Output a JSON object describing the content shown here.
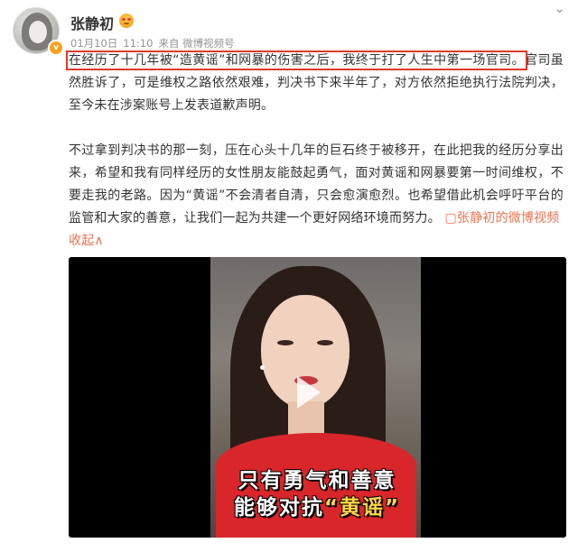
{
  "user": {
    "name": "张静初",
    "verified_badge": "v",
    "name_emoji_icon": "emoji-face-icon"
  },
  "meta": {
    "date": "01月10日",
    "time": "11:10",
    "source": "来自 微博视频号"
  },
  "post": {
    "highlighted": "在经历了十几年被“造黄谣”和网暴的伤害之后，我终于打了人生中第一场官司。",
    "p1_rest": "官司虽然胜诉了，可是维权之路依然艰难，判决书下来半年了，对方依然拒绝执行法院判决，至今未在涉案账号上发表道歉声明。",
    "p2": "不过拿到判决书的那一刻，压在心头十几年的巨石终于被移开，在此把我的经历分享出来，希望和我有同样经历的女性朋友能鼓起勇气，面对黄谣和网暴要第一时间维权，不要走我的老路。因为“黄谣”不会清者自清，只会愈演愈烈。也希望借此机会呼吁平台的监管和大家的善意，让我们一起为共建一个更好网络环境而努力。",
    "video_link": "张静初的微博视频",
    "fold": "收起"
  },
  "video": {
    "caption_line1": "只有勇气和善意",
    "caption_line2_prefix": "能够对抗",
    "caption_line2_quoted": "“黄谣”"
  },
  "colors": {
    "highlight_border": "#e03a2b",
    "link": "#eb7350",
    "badge": "#f7a11e",
    "caption_quote": "#ffd54a"
  }
}
